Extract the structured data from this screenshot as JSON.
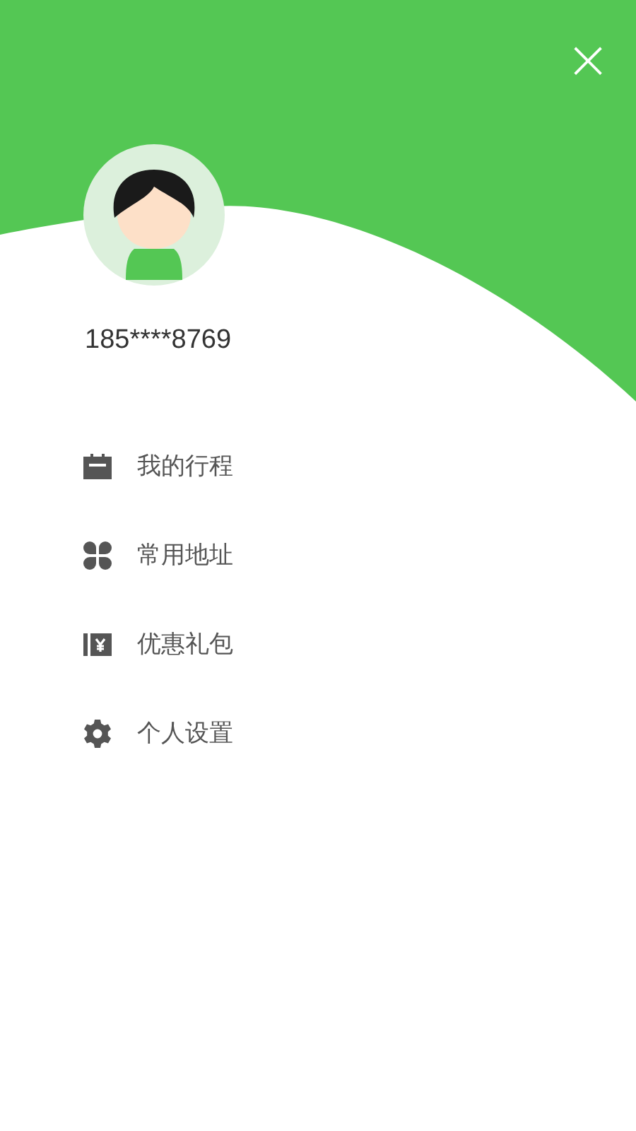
{
  "header": {
    "close": "×"
  },
  "profile": {
    "phone": "185****8769"
  },
  "menu": [
    {
      "kind": "calendar",
      "label": "我的行程"
    },
    {
      "kind": "clover",
      "label": "常用地址"
    },
    {
      "kind": "coupon",
      "label": "优惠礼包"
    },
    {
      "kind": "gear",
      "label": "个人设置"
    }
  ]
}
